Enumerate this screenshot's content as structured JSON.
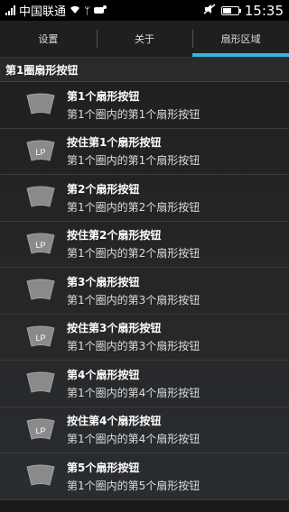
{
  "status": {
    "carrier": "中国联通",
    "time": "15:35",
    "battery_level": 0.55
  },
  "tabs": [
    {
      "label": "设置",
      "active": false
    },
    {
      "label": "关于",
      "active": false
    },
    {
      "label": "扇形区域",
      "active": true
    }
  ],
  "section": {
    "title": "第1圈扇形按钮"
  },
  "items": [
    {
      "title": "第1个扇形按钮",
      "subtitle": "第1个圈内的第1个扇形按钮",
      "icon_label": ""
    },
    {
      "title": "按住第1个扇形按钮",
      "subtitle": "第1个圈内的第1个扇形按钮",
      "icon_label": "LP"
    },
    {
      "title": "第2个扇形按钮",
      "subtitle": "第1个圈内的第2个扇形按钮",
      "icon_label": ""
    },
    {
      "title": "按住第2个扇形按钮",
      "subtitle": "第1个圈内的第2个扇形按钮",
      "icon_label": "LP"
    },
    {
      "title": "第3个扇形按钮",
      "subtitle": "第1个圈内的第3个扇形按钮",
      "icon_label": ""
    },
    {
      "title": "按住第3个扇形按钮",
      "subtitle": "第1个圈内的第3个扇形按钮",
      "icon_label": "LP"
    },
    {
      "title": "第4个扇形按钮",
      "subtitle": "第1个圈内的第4个扇形按钮",
      "icon_label": ""
    },
    {
      "title": "按住第4个扇形按钮",
      "subtitle": "第1个圈内的第4个扇形按钮",
      "icon_label": "LP"
    },
    {
      "title": "第5个扇形按钮",
      "subtitle": "第1个圈内的第5个扇形按钮",
      "icon_label": ""
    }
  ],
  "colors": {
    "accent": "#33b5e5"
  }
}
